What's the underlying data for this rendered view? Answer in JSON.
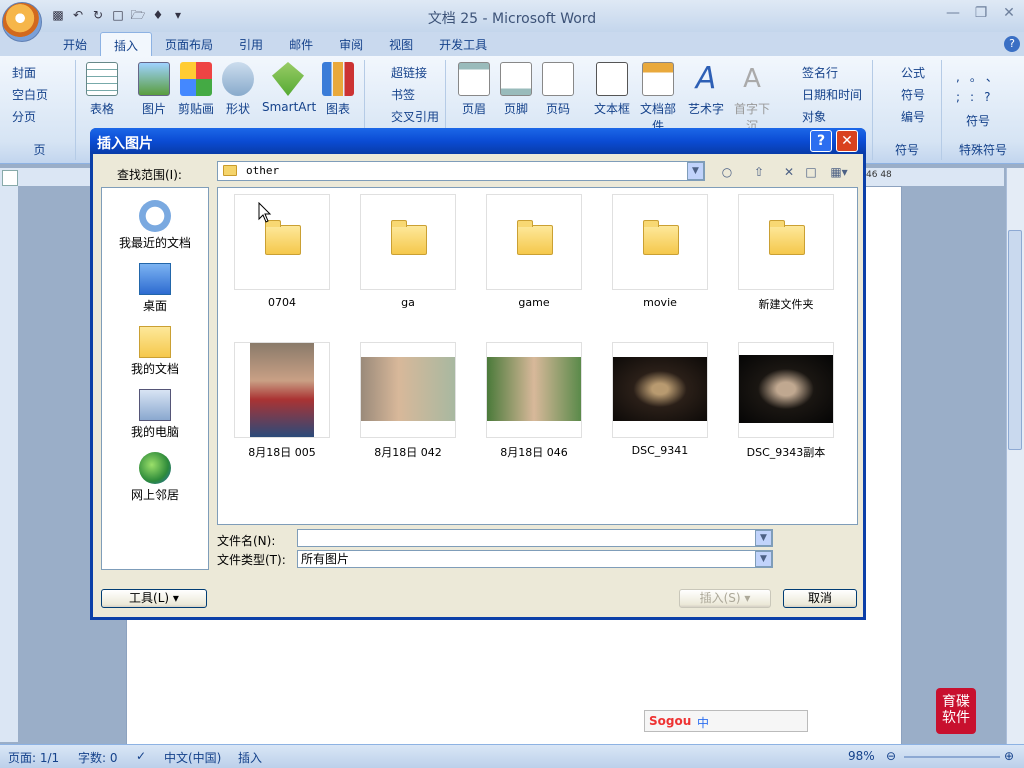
{
  "window": {
    "title": "文档 25 - Microsoft Word"
  },
  "tabs": [
    "开始",
    "插入",
    "页面布局",
    "引用",
    "邮件",
    "审阅",
    "视图",
    "开发工具"
  ],
  "ribbon": {
    "pages_group": {
      "items": [
        "封面",
        "空白页",
        "分页"
      ],
      "name": "页"
    },
    "table": "表格",
    "illustrations": [
      "图片",
      "剪贴画",
      "形状",
      "SmartArt",
      "图表"
    ],
    "links": [
      "超链接",
      "书签",
      "交叉引用"
    ],
    "header_footer": [
      "页眉",
      "页脚",
      "页码"
    ],
    "text": [
      "文本框",
      "文档部件",
      "艺术字",
      "首字下沉"
    ],
    "text_small": [
      "签名行",
      "日期和时间",
      "对象"
    ],
    "symbols": {
      "items": [
        "公式",
        "符号",
        "编号"
      ],
      "name": "符号"
    },
    "special": {
      "items": [
        "符号"
      ],
      "glyphs": [
        ",",
        "。",
        "、",
        ";",
        ":",
        "?"
      ],
      "name": "特殊符号"
    }
  },
  "ruler": {
    "numbers": "46  48"
  },
  "status": {
    "page": "页面: 1/1",
    "words": "字数: 0",
    "lang": "中文(中国)",
    "mode": "插入",
    "zoom": "98%"
  },
  "dialog": {
    "title": "插入图片",
    "lookin_label": "查找范围(I):",
    "lookin_value": "other",
    "places": [
      "我最近的文档",
      "桌面",
      "我的文档",
      "我的电脑",
      "网上邻居"
    ],
    "folders": [
      "0704",
      "ga",
      "game",
      "movie",
      "新建文件夹"
    ],
    "images": [
      "8月18日 005",
      "8月18日 042",
      "8月18日 046",
      "DSC_9341",
      "DSC_9343副本"
    ],
    "fname_label": "文件名(N):",
    "fname_value": "",
    "ftype_label": "文件类型(T):",
    "ftype_value": "所有图片",
    "tools_button": "工具(L)",
    "insert_button": "插入(S)",
    "cancel_button": "取消"
  },
  "watermark": {
    "text": "育碟软件"
  },
  "ime": {
    "brand": "Sogou",
    "mode": "中"
  }
}
